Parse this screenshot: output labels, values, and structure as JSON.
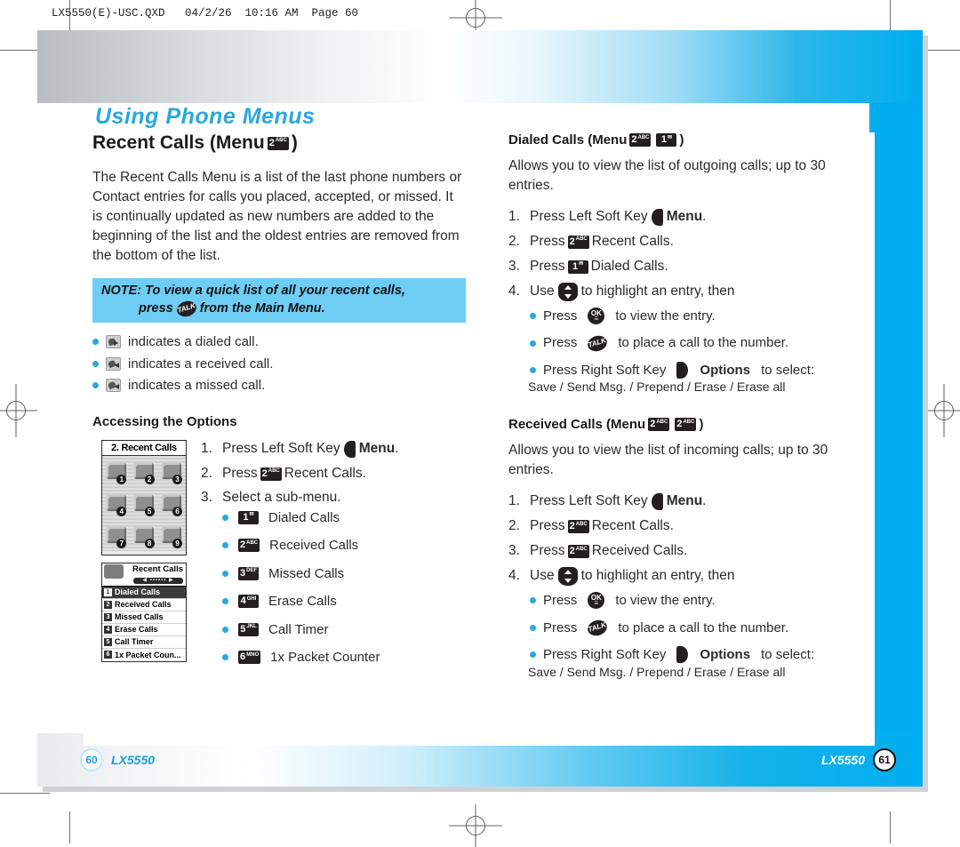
{
  "file_header": "LX5550(E)-USC.QXD   04/2/26  10:16 AM  Page 60",
  "chapter_title": "Using Phone Menus",
  "colors": {
    "accent_blue": "#00aeef",
    "note_bg": "#6ecdf5",
    "key_black": "#231f20"
  },
  "left_column": {
    "section_title": "Recent Calls (Menu",
    "section_title_close": ")",
    "section_key": {
      "digit": "2",
      "letters": "ABC"
    },
    "intro": "The Recent Calls Menu is a list of the last phone numbers or Contact entries for calls you placed, accepted, or missed. It is continually updated as new numbers are added to the beginning of the list and the oldest entries are removed from the bottom of the list.",
    "note": {
      "line1": "NOTE: To view a quick list of all your recent calls,",
      "line2_before": "press",
      "line2_key": "TALK",
      "line2_after": "from the Main Menu."
    },
    "indicators": [
      {
        "icon": "dialed-call-icon",
        "text": "indicates a dialed call."
      },
      {
        "icon": "received-call-icon",
        "text": "indicates a received call."
      },
      {
        "icon": "missed-call-icon",
        "text": "indicates a missed call."
      }
    ],
    "accessing_heading": "Accessing the Options",
    "steps": [
      {
        "num": "1.",
        "before": "Press Left Soft Key",
        "icon": "left-soft-key",
        "bold": "Menu",
        "after": "."
      },
      {
        "num": "2.",
        "before": "Press",
        "key": {
          "digit": "2",
          "letters": "ABC"
        },
        "after": "Recent Calls."
      },
      {
        "num": "3.",
        "before": "Select a sub-menu.",
        "key": null,
        "after": ""
      }
    ],
    "submenu": [
      {
        "key": {
          "digit": "1",
          "letters": "✉"
        },
        "label": "Dialed Calls"
      },
      {
        "key": {
          "digit": "2",
          "letters": "ABC"
        },
        "label": "Received Calls"
      },
      {
        "key": {
          "digit": "3",
          "letters": "DEF"
        },
        "label": "Missed Calls"
      },
      {
        "key": {
          "digit": "4",
          "letters": "GHI"
        },
        "label": "Erase Calls"
      },
      {
        "key": {
          "digit": "5",
          "letters": "JKL"
        },
        "label": "Call Timer"
      },
      {
        "key": {
          "digit": "6",
          "letters": "MNO"
        },
        "label": "1x Packet Counter"
      }
    ],
    "phone_screen_1": {
      "title": "2. Recent Calls",
      "badges": [
        "1",
        "2",
        "3",
        "4",
        "5",
        "6",
        "7",
        "8",
        "9"
      ]
    },
    "phone_screen_2": {
      "title": "Recent Calls",
      "items": [
        {
          "num": "1",
          "label": "Dialed Calls",
          "selected": true
        },
        {
          "num": "2",
          "label": "Received Calls",
          "selected": false
        },
        {
          "num": "3",
          "label": "Missed Calls",
          "selected": false
        },
        {
          "num": "4",
          "label": "Erase Calls",
          "selected": false
        },
        {
          "num": "5",
          "label": "Call Timer",
          "selected": false
        },
        {
          "num": "6",
          "label": "1x Packet Coun...",
          "selected": false
        }
      ]
    }
  },
  "right_column": {
    "dialed": {
      "heading_before": "Dialed Calls (Menu",
      "heading_close": ")",
      "keys": [
        {
          "digit": "2",
          "letters": "ABC"
        },
        {
          "digit": "1",
          "letters": "✉"
        }
      ],
      "intro": "Allows you to view the list of outgoing calls; up to 30 entries.",
      "steps": [
        {
          "num": "1.",
          "before": "Press Left Soft Key",
          "icon": "left-soft-key",
          "bold": "Menu",
          "after": "."
        },
        {
          "num": "2.",
          "before": "Press",
          "key": {
            "digit": "2",
            "letters": "ABC"
          },
          "after": "Recent Calls."
        },
        {
          "num": "3.",
          "before": "Press",
          "key": {
            "digit": "1",
            "letters": "✉"
          },
          "after": "Dialed Calls."
        },
        {
          "num": "4.",
          "before": "Use",
          "icon": "nav-key",
          "after": "to highlight an entry, then"
        }
      ],
      "bullets": [
        {
          "before": "Press",
          "icon": "ok-key",
          "after": "to view the entry."
        },
        {
          "before": "Press",
          "icon": "talk-key",
          "after": "to place a call to the number."
        },
        {
          "before": "Press Right Soft Key",
          "icon": "right-soft-key",
          "bold": "Options",
          "after": "to select:"
        }
      ],
      "options_line": "Save / Send Msg. / Prepend / Erase / Erase all"
    },
    "received": {
      "heading_before": "Received Calls (Menu",
      "heading_close": ")",
      "keys": [
        {
          "digit": "2",
          "letters": "ABC"
        },
        {
          "digit": "2",
          "letters": "ABC"
        }
      ],
      "intro": "Allows you to view the list of incoming calls; up to 30 entries.",
      "steps": [
        {
          "num": "1.",
          "before": "Press Left Soft Key",
          "icon": "left-soft-key",
          "bold": "Menu",
          "after": "."
        },
        {
          "num": "2.",
          "before": "Press",
          "key": {
            "digit": "2",
            "letters": "ABC"
          },
          "after": "Recent Calls."
        },
        {
          "num": "3.",
          "before": "Press",
          "key": {
            "digit": "2",
            "letters": "ABC"
          },
          "after": "Received Calls."
        },
        {
          "num": "4.",
          "before": "Use",
          "icon": "nav-key",
          "after": "to highlight an entry, then"
        }
      ],
      "bullets": [
        {
          "before": "Press",
          "icon": "ok-key",
          "after": "to view the entry."
        },
        {
          "before": "Press",
          "icon": "talk-key",
          "after": "to place a call to the number."
        },
        {
          "before": "Press Right Soft Key",
          "icon": "right-soft-key",
          "bold": "Options",
          "after": "to select:"
        }
      ],
      "options_line": "Save / Send Msg. / Prepend / Erase / Erase all"
    }
  },
  "footer": {
    "left_page": "60",
    "left_model": "LX5550",
    "right_model": "LX5550",
    "right_page": "61"
  },
  "ok_key": {
    "top": "OK",
    "bottom": "☰"
  },
  "talk_key_label": "TALK"
}
